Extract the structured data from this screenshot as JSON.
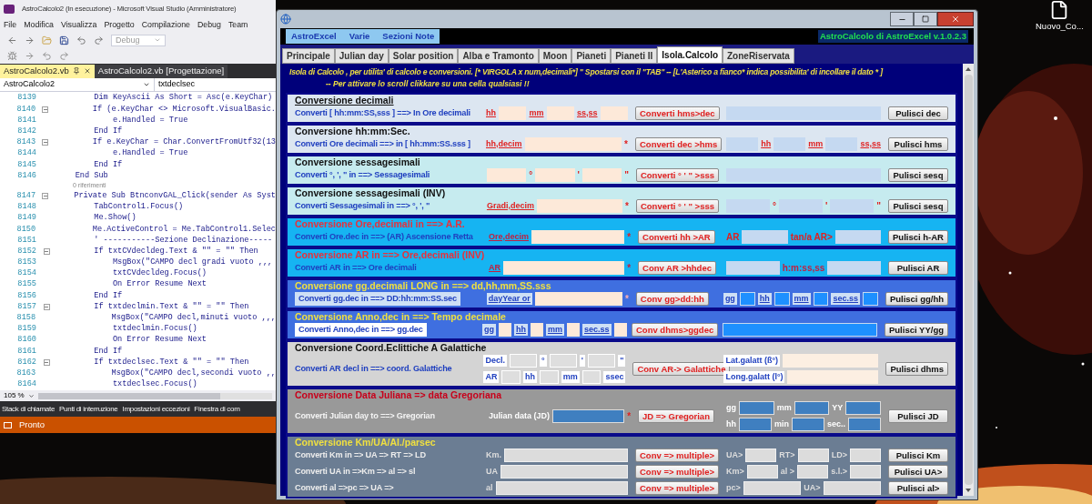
{
  "vs": {
    "title": "AstroCalcolo2 (In esecuzione) - Microsoft Visual Studio  (Amministratore)",
    "menu": [
      "File",
      "Modifica",
      "Visualizza",
      "Progetto",
      "Compilazione",
      "Debug",
      "Team"
    ],
    "config": "Debug",
    "tabs": [
      {
        "label": "AstroCalcolo2.vb",
        "selected": true
      },
      {
        "label": "AstroCalcolo2.vb [Progettazione]",
        "selected": false
      }
    ],
    "nav": [
      "AstroCalcolo2",
      "txtdeclsec"
    ],
    "lines": [
      {
        "kind": "code",
        "num": "8139",
        "fold": false,
        "code": "        Dim KeyAscii As Short = Asc(e.KeyChar)"
      },
      {
        "kind": "code",
        "num": "8140",
        "fold": true,
        "code": "        If (e.KeyChar <> Microsoft.VisualBasic."
      },
      {
        "kind": "code",
        "num": "8141",
        "fold": false,
        "code": "            e.Handled = True"
      },
      {
        "kind": "code",
        "num": "8142",
        "fold": false,
        "code": "        End If"
      },
      {
        "kind": "code",
        "num": "8143",
        "fold": true,
        "code": "        If e.KeyChar = Char.ConvertFromUtf32(13"
      },
      {
        "kind": "code",
        "num": "8144",
        "fold": false,
        "code": "            e.Handled = True"
      },
      {
        "kind": "code",
        "num": "8145",
        "fold": false,
        "code": "        End If"
      },
      {
        "kind": "code",
        "num": "8146",
        "fold": false,
        "code": "    End Sub"
      },
      {
        "kind": "lens",
        "text": "0 riferimenti"
      },
      {
        "kind": "code",
        "num": "8147",
        "fold": true,
        "code": "    Private Sub BtnconvGAL_Click(sender As Syst"
      },
      {
        "kind": "code",
        "num": "8148",
        "fold": false,
        "code": "        TabControl1.Focus()"
      },
      {
        "kind": "code",
        "num": "8149",
        "fold": false,
        "code": "        Me.Show()"
      },
      {
        "kind": "code",
        "num": "8150",
        "fold": false,
        "code": "        Me.ActiveControl = Me.TabControl1.Selec"
      },
      {
        "kind": "code",
        "num": "8151",
        "fold": false,
        "code": "        ' -----------Sezione Declinazione-----"
      },
      {
        "kind": "code",
        "num": "8152",
        "fold": true,
        "code": "        If txtCVdecldeg.Text & \"\" = \"\" Then"
      },
      {
        "kind": "code",
        "num": "8153",
        "fold": false,
        "code": "            MsgBox(\"CAMPO decl gradi vuoto ,,,"
      },
      {
        "kind": "code",
        "num": "8154",
        "fold": false,
        "code": "            txtCVdecldeg.Focus()"
      },
      {
        "kind": "code",
        "num": "8155",
        "fold": false,
        "code": "            On Error Resume Next"
      },
      {
        "kind": "code",
        "num": "8156",
        "fold": false,
        "code": "        End If"
      },
      {
        "kind": "code",
        "num": "8157",
        "fold": true,
        "code": "        If txtdeclmin.Text & \"\" = \"\" Then"
      },
      {
        "kind": "code",
        "num": "8158",
        "fold": false,
        "code": "            MsgBox(\"CAMPO decl,minuti vuoto ,,,"
      },
      {
        "kind": "code",
        "num": "8159",
        "fold": false,
        "code": "            txtdeclmin.Focus()"
      },
      {
        "kind": "code",
        "num": "8160",
        "fold": false,
        "code": "            On Error Resume Next"
      },
      {
        "kind": "code",
        "num": "8161",
        "fold": false,
        "code": "        End If"
      },
      {
        "kind": "code",
        "num": "8162",
        "fold": true,
        "code": "        If txtdeclsec.Text & \"\" = \"\" Then"
      },
      {
        "kind": "code",
        "num": "8163",
        "fold": false,
        "code": "            MsgBox(\"CAMPO decl,secondi vuoto ,,"
      },
      {
        "kind": "code",
        "num": "8164",
        "fold": false,
        "code": "            txtdeclsec.Focus()"
      }
    ],
    "zoom": "105 %",
    "tool_tabs": [
      "Stack di chiamate",
      "Punti di interruzione",
      "Impostazioni eccezioni",
      "Finestra di com"
    ],
    "status": "Pronto"
  },
  "desktop_icon": "Nuovo_Co...",
  "app": {
    "menu": [
      "AstroExcel",
      "Varie",
      "Sezioni Note"
    ],
    "version": "AstroCalcolo di AstroExcel v.1.0.2.3",
    "tabs": [
      {
        "label": "Principale",
        "selected": false
      },
      {
        "label": "Julian day",
        "selected": false
      },
      {
        "label": "Solar position",
        "selected": false
      },
      {
        "label": "Alba e Tramonto",
        "selected": false
      },
      {
        "label": "Moon",
        "selected": false
      },
      {
        "label": "Pianeti",
        "selected": false
      },
      {
        "label": "Pianeti II",
        "selected": false
      },
      {
        "label": "Isola.Calcolo",
        "selected": true
      },
      {
        "label": "ZoneRiservata",
        "selected": false
      }
    ],
    "header": [
      "Isola di Calcolo , per utilita' di calcolo e conversioni. [* VIRGOLA x num,decimali*]  \" Spostarsi con il \"TAB\"  --  [L'Asterico a fianco* indica possibilita' di incollare il dato * ]",
      "-- Per attivare lo scroll clikkare su una cella qualsiasi !!"
    ],
    "sections": [
      {
        "title": "Conversione  decimali",
        "labels": [
          "Converti [ hh:mm:SS,sss ] ==>  In Ore decimali"
        ],
        "inputs": [
          [
            {
              "kind": "tag",
              "text": "hh"
            },
            {
              "kind": "field"
            },
            {
              "kind": "tag",
              "text": "mm"
            },
            {
              "kind": "field"
            },
            {
              "kind": "tag",
              "text": "ss,ss"
            },
            {
              "kind": "field"
            }
          ]
        ],
        "buttons": [
          "Converti hms>dec"
        ],
        "outputs": [
          [
            {
              "kind": "field"
            }
          ]
        ],
        "clear": [
          "Pulisci dec"
        ]
      },
      {
        "title": "Conversione hh:mm:Sec.",
        "labels": [
          "Converti Ore decimali  ==> in [ hh:mm:SS.sss ]"
        ],
        "inputs": [
          [
            {
              "kind": "tag",
              "text": "hh,decim"
            },
            {
              "kind": "field"
            },
            {
              "kind": "star",
              "text": "*"
            }
          ]
        ],
        "buttons": [
          "Converti dec >hms"
        ],
        "outputs": [
          [
            {
              "kind": "field"
            },
            {
              "kind": "tag",
              "text": "hh"
            },
            {
              "kind": "field"
            },
            {
              "kind": "tag",
              "text": "mm"
            },
            {
              "kind": "field"
            },
            {
              "kind": "tag",
              "text": "ss,ss"
            }
          ]
        ],
        "clear": [
          "Pulisci hms"
        ]
      },
      {
        "title": "Conversione sessagesimali",
        "labels": [
          "Converti  °, ', \"  in  ==> Sessagesimali"
        ],
        "inputs": [
          [
            {
              "kind": "field"
            },
            {
              "kind": "star",
              "text": "°"
            },
            {
              "kind": "field"
            },
            {
              "kind": "star",
              "text": "'"
            },
            {
              "kind": "field"
            },
            {
              "kind": "star",
              "text": "\""
            }
          ]
        ],
        "buttons": [
          "Converti ° ' \" >sss"
        ],
        "outputs": [
          [
            {
              "kind": "field"
            }
          ]
        ],
        "clear": [
          "Pulisci sesq"
        ]
      },
      {
        "title": "Conversione sessagesimali (INV)",
        "labels": [
          "Converti  Sessagesimali  in ==> °, ', \""
        ],
        "inputs": [
          [
            {
              "kind": "tag",
              "text": "Gradi,decim"
            },
            {
              "kind": "field"
            },
            {
              "kind": "star",
              "text": "*"
            }
          ]
        ],
        "buttons": [
          "Converti ° ' \" >sss"
        ],
        "outputs": [
          [
            {
              "kind": "field"
            },
            {
              "kind": "star",
              "text": "°"
            },
            {
              "kind": "field"
            },
            {
              "kind": "star",
              "text": "'"
            },
            {
              "kind": "field"
            },
            {
              "kind": "star",
              "text": "\""
            }
          ]
        ],
        "clear": [
          "Pulisci sesq"
        ]
      },
      {
        "title": "Conversione Ore,decimali in ==> A.R.",
        "labels": [
          "Converti  Ore.dec in ==> (AR) Ascensione Retta"
        ],
        "inputs": [
          [
            {
              "kind": "tag",
              "text": "Ore,decim"
            },
            {
              "kind": "field"
            },
            {
              "kind": "star",
              "text": "*"
            }
          ]
        ],
        "buttons": [
          "Converti hh >AR"
        ],
        "outputs": [
          [
            {
              "kind": "star",
              "text": "AR"
            },
            {
              "kind": "field"
            },
            {
              "kind": "star",
              "text": "tan/a AR>"
            },
            {
              "kind": "field"
            }
          ]
        ],
        "clear": [
          "Pulisci h-AR"
        ]
      },
      {
        "title": "Conversione AR in ==> Ore,decimali (INV)",
        "labels": [
          "Converti  AR in ==> Ore decimali"
        ],
        "inputs": [
          [
            {
              "kind": "tag",
              "text": "AR"
            },
            {
              "kind": "field"
            },
            {
              "kind": "star",
              "text": "*"
            }
          ]
        ],
        "buttons": [
          "Conv AR >hhdec"
        ],
        "outputs": [
          [
            {
              "kind": "field"
            },
            {
              "kind": "star",
              "text": "h:m:ss,ss"
            },
            {
              "kind": "field"
            }
          ]
        ],
        "clear": [
          "Pulisci AR"
        ]
      },
      {
        "title": "Conversione gg.decimali LONG in ==> dd,hh,mm,SS.sss",
        "labels": [
          "Converti gg.dec in ==> DD:hh:mm:SS.sec"
        ],
        "inputs": [
          [
            {
              "kind": "tag",
              "text": "dayYear or"
            },
            {
              "kind": "field"
            },
            {
              "kind": "star",
              "text": "*"
            }
          ]
        ],
        "buttons": [
          "Conv gg>dd:hh"
        ],
        "outputs": [
          [
            {
              "kind": "tag",
              "text": "gg"
            },
            {
              "kind": "field"
            },
            {
              "kind": "tag",
              "text": "hh"
            },
            {
              "kind": "field"
            },
            {
              "kind": "tag",
              "text": "mm"
            },
            {
              "kind": "field"
            },
            {
              "kind": "tag",
              "text": "sec.ss"
            },
            {
              "kind": "field"
            }
          ]
        ],
        "clear": [
          "Pulisci gg/hh"
        ]
      },
      {
        "title": "Conversione Anno,dec in ==> Tempo decimale",
        "labels": [
          "Converti Anno,dec  in ==> gg.dec"
        ],
        "inputs": [
          [
            {
              "kind": "tag",
              "text": "gg"
            },
            {
              "kind": "field"
            },
            {
              "kind": "tag",
              "text": "hh"
            },
            {
              "kind": "field"
            },
            {
              "kind": "tag",
              "text": "mm"
            },
            {
              "kind": "field"
            },
            {
              "kind": "tag",
              "text": "sec.ss"
            },
            {
              "kind": "field"
            }
          ]
        ],
        "buttons": [
          "Conv dhms>ggdec"
        ],
        "outputs": [
          [
            {
              "kind": "field"
            }
          ]
        ],
        "clear": [
          "Pulisci YY/gg"
        ]
      },
      {
        "title": "Conversione Coord.Eclittiche A Galattiche",
        "labels": [
          "Converti AR  decl in ==> coord. Galattiche"
        ],
        "inputs": [
          [
            {
              "kind": "tag",
              "text": "Decl."
            },
            {
              "kind": "field"
            },
            {
              "kind": "tag",
              "text": "°"
            },
            {
              "kind": "field"
            },
            {
              "kind": "tag",
              "text": "'"
            },
            {
              "kind": "field"
            },
            {
              "kind": "tag",
              "text": "\""
            }
          ],
          [
            {
              "kind": "tag",
              "text": "AR"
            },
            {
              "kind": "field"
            },
            {
              "kind": "tag",
              "text": "hh"
            },
            {
              "kind": "field"
            },
            {
              "kind": "tag",
              "text": "mm"
            },
            {
              "kind": "field"
            },
            {
              "kind": "tag",
              "text": "ssec"
            }
          ]
        ],
        "buttons": [
          "Conv AR-> Galattiche"
        ],
        "outputs": [
          [
            {
              "kind": "text",
              "text": "Lat.galatt (ß°)"
            },
            {
              "kind": "field"
            }
          ],
          [
            {
              "kind": "text",
              "text": "Long.galatt (l°)"
            },
            {
              "kind": "field"
            }
          ]
        ],
        "clear": [
          "Pulisci dhms"
        ]
      },
      {
        "title": "Conversione Data Juliana => data Gregoriana",
        "labels": [
          "Converti Julian day to ==> Gregorian"
        ],
        "inputs": [
          [
            {
              "kind": "text",
              "text": "Julian data (JD)"
            },
            {
              "kind": "field"
            },
            {
              "kind": "star",
              "text": "*"
            }
          ]
        ],
        "buttons": [
          "JD => Gregorian"
        ],
        "outputs": [
          [
            {
              "kind": "text",
              "text": "gg"
            },
            {
              "kind": "field"
            },
            {
              "kind": "text",
              "text": "mm"
            },
            {
              "kind": "field"
            },
            {
              "kind": "text",
              "text": "YY"
            },
            {
              "kind": "field"
            }
          ],
          [
            {
              "kind": "text",
              "text": "hh"
            },
            {
              "kind": "field"
            },
            {
              "kind": "text",
              "text": "min"
            },
            {
              "kind": "field"
            },
            {
              "kind": "text",
              "text": "sec.."
            },
            {
              "kind": "field"
            }
          ]
        ],
        "clear": [
          "Pulisci JD"
        ]
      },
      {
        "title": "Conversione Km/UA/Al./parsec",
        "labels": [
          "Converti Km in => UA  => RT => LD",
          "Converti UA in =>Km => al => sl",
          "Converti al =>pc => UA =>"
        ],
        "inputs": [
          [
            {
              "kind": "text",
              "text": "Km."
            },
            {
              "kind": "field"
            }
          ],
          [
            {
              "kind": "text",
              "text": "UA"
            },
            {
              "kind": "field"
            }
          ],
          [
            {
              "kind": "text",
              "text": "al"
            },
            {
              "kind": "field"
            }
          ]
        ],
        "buttons": [
          "Conv => multiple>",
          "Conv => multiple>",
          "Conv => multiple>"
        ],
        "outputs": [
          [
            {
              "kind": "text",
              "text": "UA>"
            },
            {
              "kind": "field"
            },
            {
              "kind": "text",
              "text": "RT>"
            },
            {
              "kind": "field"
            },
            {
              "kind": "text",
              "text": "LD>"
            },
            {
              "kind": "field"
            }
          ],
          [
            {
              "kind": "text",
              "text": "Km>"
            },
            {
              "kind": "field"
            },
            {
              "kind": "text",
              "text": "al >"
            },
            {
              "kind": "field"
            },
            {
              "kind": "text",
              "text": "s.l.>"
            },
            {
              "kind": "field"
            }
          ],
          [
            {
              "kind": "text",
              "text": "pc>"
            },
            {
              "kind": "field"
            },
            {
              "kind": "text",
              "text": "UA>"
            },
            {
              "kind": "field"
            }
          ]
        ],
        "clear": [
          "Pulisci Km",
          "Pulisci UA>",
          "Pulisci al>"
        ]
      }
    ]
  }
}
